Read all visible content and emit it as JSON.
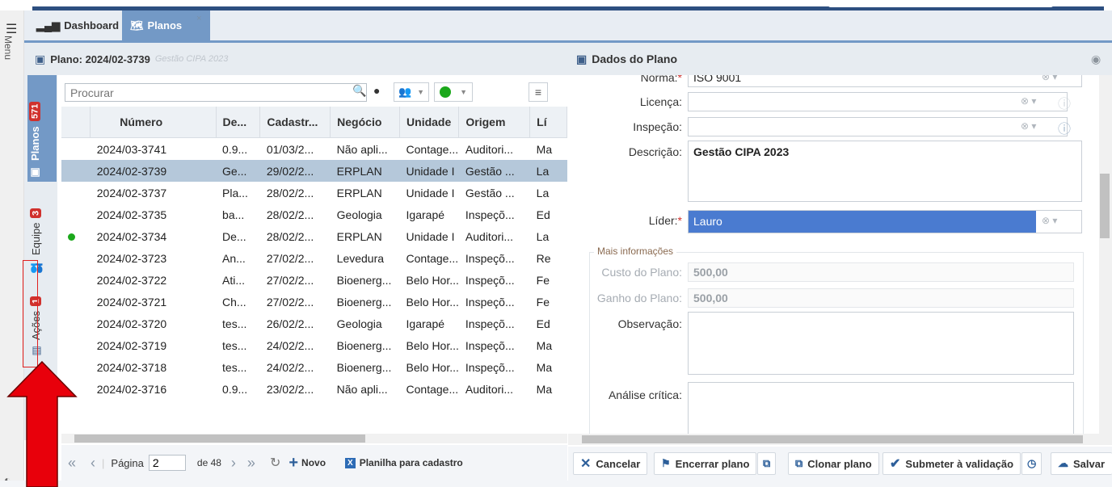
{
  "menu": {
    "label": "Menu"
  },
  "tabs": [
    {
      "label": "Dashboard"
    },
    {
      "label": "Planos",
      "close": "×"
    }
  ],
  "plan_header": {
    "title": "Plano: 2024/02-3739",
    "subtitle": "Gestão CIPA 2023"
  },
  "side_tabs": [
    {
      "label": "Planos",
      "count": "571"
    },
    {
      "label": "Equipe",
      "count": "3"
    },
    {
      "label": "Ações",
      "count": "1"
    }
  ],
  "grid": {
    "search_placeholder": "Procurar",
    "columns": [
      "Número",
      "De...",
      "Cadastr...",
      "Negócio",
      "Unidade",
      "Origem",
      "Lí"
    ],
    "rows": [
      {
        "status": "",
        "numero": "2024/03-3741",
        "desc": "0.9...",
        "cadastro": "01/03/2...",
        "negocio": "Não apli...",
        "unidade": "Contage...",
        "origem": "Auditori...",
        "lider": "Ma"
      },
      {
        "status": "",
        "numero": "2024/02-3739",
        "desc": "Ge...",
        "cadastro": "29/02/2...",
        "negocio": "ERPLAN",
        "unidade": "Unidade I",
        "origem": "Gestão ...",
        "lider": "La"
      },
      {
        "status": "",
        "numero": "2024/02-3737",
        "desc": "Pla...",
        "cadastro": "28/02/2...",
        "negocio": "ERPLAN",
        "unidade": "Unidade I",
        "origem": "Gestão ...",
        "lider": "La"
      },
      {
        "status": "",
        "numero": "2024/02-3735",
        "desc": "ba...",
        "cadastro": "28/02/2...",
        "negocio": "Geologia",
        "unidade": "Igarapé",
        "origem": "Inspeçõ...",
        "lider": "Ed"
      },
      {
        "status": "green",
        "numero": "2024/02-3734",
        "desc": "De...",
        "cadastro": "28/02/2...",
        "negocio": "ERPLAN",
        "unidade": "Unidade I",
        "origem": "Auditori...",
        "lider": "La"
      },
      {
        "status": "",
        "numero": "2024/02-3723",
        "desc": "An...",
        "cadastro": "27/02/2...",
        "negocio": "Levedura",
        "unidade": "Contage...",
        "origem": "Inspeçõ...",
        "lider": "Re"
      },
      {
        "status": "",
        "numero": "2024/02-3722",
        "desc": "Ati...",
        "cadastro": "27/02/2...",
        "negocio": "Bioenerg...",
        "unidade": "Belo Hor...",
        "origem": "Inspeçõ...",
        "lider": "Fe"
      },
      {
        "status": "",
        "numero": "2024/02-3721",
        "desc": "Ch...",
        "cadastro": "27/02/2...",
        "negocio": "Bioenerg...",
        "unidade": "Belo Hor...",
        "origem": "Inspeçõ...",
        "lider": "Fe"
      },
      {
        "status": "",
        "numero": "2024/02-3720",
        "desc": "tes...",
        "cadastro": "26/02/2...",
        "negocio": "Geologia",
        "unidade": "Igarapé",
        "origem": "Inspeçõ...",
        "lider": "Ed"
      },
      {
        "status": "",
        "numero": "2024/02-3719",
        "desc": "tes...",
        "cadastro": "24/02/2...",
        "negocio": "Bioenerg...",
        "unidade": "Belo Hor...",
        "origem": "Inspeçõ...",
        "lider": "Ma"
      },
      {
        "status": "",
        "numero": "2024/02-3718",
        "desc": "tes...",
        "cadastro": "24/02/2...",
        "negocio": "Bioenerg...",
        "unidade": "Belo Hor...",
        "origem": "Inspeçõ...",
        "lider": "Ma"
      },
      {
        "status": "",
        "numero": "2024/02-3716",
        "desc": "0.9...",
        "cadastro": "23/02/2...",
        "negocio": "Não apli...",
        "unidade": "Contage...",
        "origem": "Auditori...",
        "lider": "Ma"
      }
    ],
    "selected_index": 1
  },
  "pager": {
    "page_label": "Página",
    "page_value": "2",
    "of_label": "de 48",
    "new_label": "Novo",
    "export_label": "Planilha para cadastro"
  },
  "details": {
    "title": "Dados do Plano",
    "fields": {
      "norma": {
        "label": "Norma:",
        "value": "ISO 9001"
      },
      "licenca": {
        "label": "Licença:",
        "value": ""
      },
      "inspecao": {
        "label": "Inspeção:",
        "value": ""
      },
      "descricao": {
        "label": "Descrição:",
        "value": "Gestão CIPA 2023"
      },
      "lider": {
        "label": "Líder:",
        "value": "Lauro"
      }
    },
    "more_legend": "Mais informações",
    "custo": {
      "label": "Custo do Plano:",
      "value": "500,00"
    },
    "ganho": {
      "label": "Ganho do Plano:",
      "value": "500,00"
    },
    "observacao": {
      "label": "Observação:"
    },
    "analise": {
      "label": "Análise crítica:"
    }
  },
  "actions": {
    "cancel": "Cancelar",
    "close_plan": "Encerrar plano",
    "clone": "Clonar plano",
    "submit": "Submeter à validação",
    "save": "Salvar"
  },
  "colors": {
    "accent": "#7399c6",
    "selected_row": "#b5c8da",
    "badge": "#d0312d",
    "lider_highlight": "#4a7bd0",
    "status_green": "#1ba81b"
  }
}
